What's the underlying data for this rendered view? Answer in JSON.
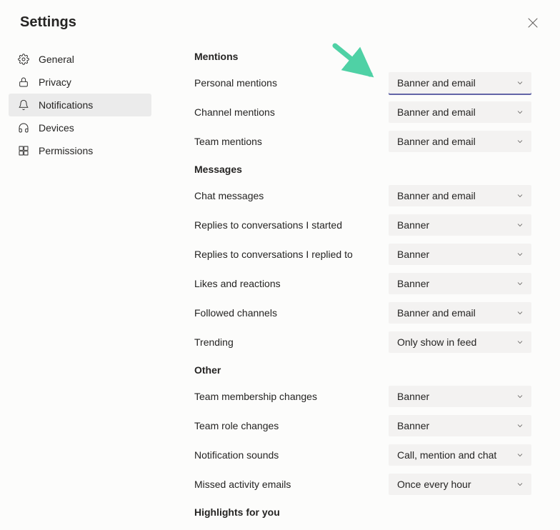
{
  "header": {
    "title": "Settings"
  },
  "sidebar": {
    "items": [
      {
        "label": "General"
      },
      {
        "label": "Privacy"
      },
      {
        "label": "Notifications"
      },
      {
        "label": "Devices"
      },
      {
        "label": "Permissions"
      }
    ]
  },
  "sections": {
    "mentions": {
      "heading": "Mentions",
      "rows": [
        {
          "label": "Personal mentions",
          "value": "Banner and email"
        },
        {
          "label": "Channel mentions",
          "value": "Banner and email"
        },
        {
          "label": "Team mentions",
          "value": "Banner and email"
        }
      ]
    },
    "messages": {
      "heading": "Messages",
      "rows": [
        {
          "label": "Chat messages",
          "value": "Banner and email"
        },
        {
          "label": "Replies to conversations I started",
          "value": "Banner"
        },
        {
          "label": "Replies to conversations I replied to",
          "value": "Banner"
        },
        {
          "label": "Likes and reactions",
          "value": "Banner"
        },
        {
          "label": "Followed channels",
          "value": "Banner and email"
        },
        {
          "label": "Trending",
          "value": "Only show in feed"
        }
      ]
    },
    "other": {
      "heading": "Other",
      "rows": [
        {
          "label": "Team membership changes",
          "value": "Banner"
        },
        {
          "label": "Team role changes",
          "value": "Banner"
        },
        {
          "label": "Notification sounds",
          "value": "Call, mention and chat"
        },
        {
          "label": "Missed activity emails",
          "value": "Once every hour"
        }
      ]
    },
    "highlights": {
      "heading": "Highlights for you"
    }
  },
  "annotation": {
    "arrow_color": "#4fd1a5"
  }
}
